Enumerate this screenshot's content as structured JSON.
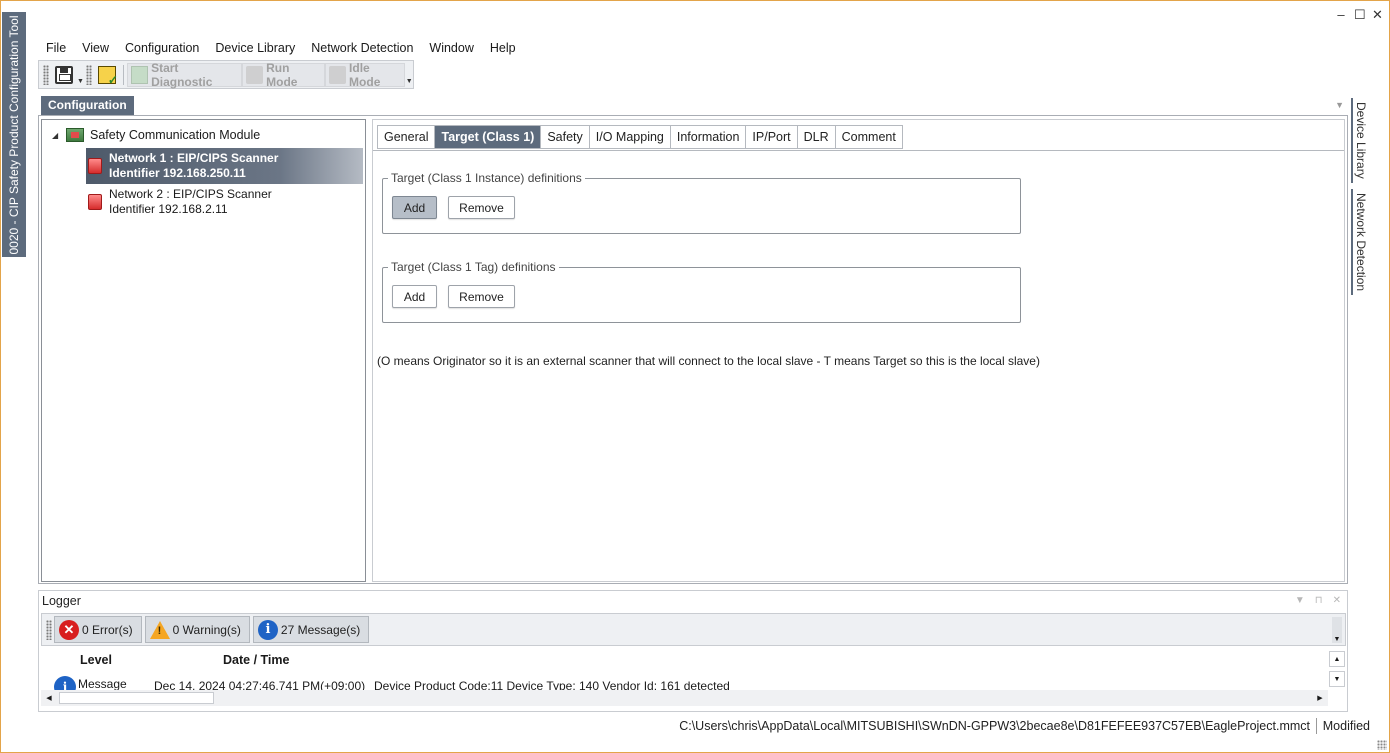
{
  "app": {
    "side_title": "0020 - CIP Safety Product Configuration Tool",
    "window_controls": {
      "minimize": "–",
      "maximize": "☐",
      "close": "✕"
    }
  },
  "menu": [
    "File",
    "View",
    "Configuration",
    "Device Library",
    "Network Detection",
    "Window",
    "Help"
  ],
  "toolbar": {
    "start_diagnostic": "Start Diagnostic",
    "run_mode": "Run Mode",
    "idle_mode": "Idle Mode"
  },
  "config_panel": {
    "title": "Configuration"
  },
  "right_tabs": [
    "Device Library",
    "Network Detection"
  ],
  "tree": {
    "root": "Safety Communication Module",
    "nodes": [
      {
        "line1": "Network 1 : EIP/CIPS Scanner",
        "line2": "Identifier 192.168.250.11",
        "selected": true
      },
      {
        "line1": "Network 2 : EIP/CIPS Scanner",
        "line2": "Identifier 192.168.2.11",
        "selected": false
      }
    ]
  },
  "tabs": [
    "General",
    "Target (Class 1)",
    "Safety",
    "I/O Mapping",
    "Information",
    "IP/Port",
    "DLR",
    "Comment"
  ],
  "active_tab": "Target (Class 1)",
  "target_content": {
    "group1": {
      "legend": "Target (Class 1 Instance) definitions",
      "add": "Add",
      "remove": "Remove"
    },
    "group2": {
      "legend": "Target (Class 1 Tag) definitions",
      "add": "Add",
      "remove": "Remove"
    },
    "note": "(O means Originator so it is an external scanner that will connect to the local slave - T means Target so this is the local slave)"
  },
  "logger": {
    "title": "Logger",
    "errors": "0 Error(s)",
    "warnings": "0 Warning(s)",
    "messages": "27 Message(s)",
    "columns": {
      "level": "Level",
      "date": "Date / Time"
    },
    "rows": [
      {
        "level": "Message",
        "date": "Dec 14, 2024 04:27:46.741 PM(+09:00)",
        "message": "Device Product Code:11 Device Type: 140 Vendor Id: 161 detected"
      }
    ]
  },
  "status": {
    "path": "C:\\Users\\chris\\AppData\\Local\\MITSUBISHI\\SWnDN-GPPW3\\2becae8e\\D81FEFEE937C57EB\\EagleProject.mmct",
    "state": "Modified"
  },
  "colors": {
    "accent": "#5d6b7d",
    "window_border": "#e3a44a",
    "error": "#d81e1e",
    "warning": "#f5a623",
    "info": "#1e63c5"
  }
}
